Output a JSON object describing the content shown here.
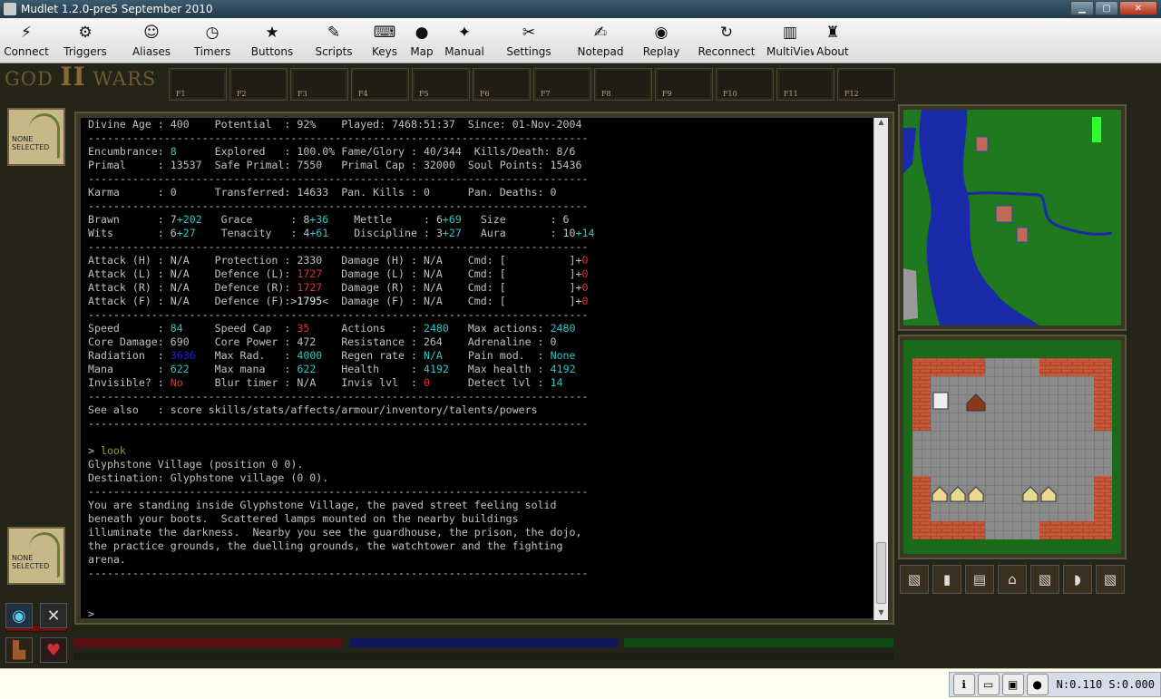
{
  "window": {
    "title": "Mudlet 1.2.0-pre5 September 2010"
  },
  "toolbar": [
    {
      "key": "connect",
      "label": "Connect",
      "icon": "⚡"
    },
    {
      "key": "triggers",
      "label": "Triggers",
      "icon": "⚙"
    },
    {
      "key": "aliases",
      "label": "Aliases",
      "icon": "☺"
    },
    {
      "key": "timers",
      "label": "Timers",
      "icon": "◷"
    },
    {
      "key": "buttons",
      "label": "Buttons",
      "icon": "★"
    },
    {
      "key": "scripts",
      "label": "Scripts",
      "icon": "✎"
    },
    {
      "key": "keys",
      "label": "Keys",
      "icon": "⌨"
    },
    {
      "key": "map",
      "label": "Map",
      "icon": "●"
    },
    {
      "key": "manual",
      "label": "Manual",
      "icon": "✦"
    },
    {
      "key": "settings",
      "label": "Settings",
      "icon": "✂"
    },
    {
      "key": "notepad",
      "label": "Notepad",
      "icon": "✍"
    },
    {
      "key": "replay",
      "label": "Replay",
      "icon": "◉"
    },
    {
      "key": "reconnect",
      "label": "Reconnect",
      "icon": "↻"
    },
    {
      "key": "multiview",
      "label": "MultiView",
      "icon": "▥"
    },
    {
      "key": "about",
      "label": "About",
      "icon": "♜"
    }
  ],
  "logo": {
    "text1": "GOD ",
    "text2": "II",
    "text3": " WARS"
  },
  "fkeys": [
    "F1",
    "F2",
    "F3",
    "F4",
    "F5",
    "F6",
    "F7",
    "F8",
    "F9",
    "F10",
    "F11",
    "F12"
  ],
  "portraits": {
    "top": "NONE\nSELECTED",
    "bottom": "NONE\nSELECTED"
  },
  "terminal": {
    "lines": [
      [
        [
          "Divine Age : 400    Potential  : 92%    Played: 7468:51:37  Since: 01-Nov-2004",
          ""
        ]
      ],
      [
        [
          "-------------------------------------------------------------------------------",
          ""
        ]
      ],
      [
        [
          "Encumbrance: ",
          ""
        ],
        [
          "8",
          "c"
        ],
        [
          "      Explored   : 100.0% Fame/Glory : 40/344  Kills/Death: 8/6",
          ""
        ]
      ],
      [
        [
          "Primal     : 13537  Safe Primal: 7550   Primal Cap : 32000  Soul Points: 15436",
          ""
        ]
      ],
      [
        [
          "-------------------------------------------------------------------------------",
          ""
        ]
      ],
      [
        [
          "Karma      : 0      Transferred: 14633  Pan. Kills : 0      Pan. Deaths: 0",
          ""
        ]
      ],
      [
        [
          "-------------------------------------------------------------------------------",
          ""
        ]
      ],
      [
        [
          "Brawn      : 7",
          ""
        ],
        [
          "+202",
          "c"
        ],
        [
          "   Grace      : 8",
          ""
        ],
        [
          "+36",
          "c"
        ],
        [
          "    Mettle     : 6",
          ""
        ],
        [
          "+69",
          "c"
        ],
        [
          "   Size       : 6",
          ""
        ]
      ],
      [
        [
          "Wits       : 6",
          ""
        ],
        [
          "+27",
          "c"
        ],
        [
          "    Tenacity   : 4",
          ""
        ],
        [
          "+61",
          "c"
        ],
        [
          "    Discipline : 3",
          ""
        ],
        [
          "+27",
          "c"
        ],
        [
          "   Aura       : 10",
          ""
        ],
        [
          "+14",
          "c"
        ]
      ],
      [
        [
          "-------------------------------------------------------------------------------",
          ""
        ]
      ],
      [
        [
          "Attack (H) : N/A    Protection : 2330   Damage (H) : N/A    Cmd: [          ]+",
          ""
        ],
        [
          "0",
          "r"
        ]
      ],
      [
        [
          "Attack (L) : N/A    Defence (L): ",
          ""
        ],
        [
          "1727",
          "r"
        ],
        [
          "   Damage (L) : N/A    Cmd: [          ]+",
          ""
        ],
        [
          "0",
          "r"
        ]
      ],
      [
        [
          "Attack (R) : N/A    Defence (R): ",
          ""
        ],
        [
          "1727",
          "r"
        ],
        [
          "   Damage (R) : N/A    Cmd: [          ]+",
          ""
        ],
        [
          "0",
          "r"
        ]
      ],
      [
        [
          "Attack (F) : N/A    Defence (F):>",
          ""
        ],
        [
          "1795",
          "w"
        ],
        [
          "<  Damage (F) : N/A    Cmd: [          ]+",
          ""
        ],
        [
          "0",
          "r"
        ]
      ],
      [
        [
          "-------------------------------------------------------------------------------",
          ""
        ]
      ],
      [
        [
          "Speed      : ",
          ""
        ],
        [
          "84",
          "c"
        ],
        [
          "     Speed Cap  : ",
          ""
        ],
        [
          "35",
          "r"
        ],
        [
          "     Actions    : ",
          ""
        ],
        [
          "2480",
          "c"
        ],
        [
          "   Max actions: ",
          ""
        ],
        [
          "2480",
          "c"
        ]
      ],
      [
        [
          "Core Damage: 690    Core Power : 472    Resistance : 264    Adrenaline : 0",
          ""
        ]
      ],
      [
        [
          "Radiation  : ",
          ""
        ],
        [
          "3636",
          "b"
        ],
        [
          "   Max Rad.   : ",
          ""
        ],
        [
          "4000",
          "c"
        ],
        [
          "   Regen rate : ",
          ""
        ],
        [
          "N/A",
          "c"
        ],
        [
          "    Pain mod.  : ",
          ""
        ],
        [
          "None",
          "c"
        ]
      ],
      [
        [
          "Mana       : ",
          ""
        ],
        [
          "622",
          "c"
        ],
        [
          "    Max mana   : ",
          ""
        ],
        [
          "622",
          "c"
        ],
        [
          "    Health     : ",
          ""
        ],
        [
          "4192",
          "c"
        ],
        [
          "   Max health : ",
          ""
        ],
        [
          "4192",
          "c"
        ]
      ],
      [
        [
          "Invisible? : ",
          ""
        ],
        [
          "No",
          "r"
        ],
        [
          "     Blur timer : N/A    Invis lvl  : ",
          ""
        ],
        [
          "0",
          "r"
        ],
        [
          "      Detect lvl : ",
          ""
        ],
        [
          "14",
          "c"
        ]
      ],
      [
        [
          "-------------------------------------------------------------------------------",
          ""
        ]
      ],
      [
        [
          "See also   : score skills/stats/affects/armour/inventory/talents/powers",
          ""
        ]
      ],
      [
        [
          "-------------------------------------------------------------------------------",
          ""
        ]
      ],
      [
        [
          "",
          ""
        ]
      ],
      [
        [
          "> ",
          ""
        ],
        [
          "look",
          "y"
        ]
      ],
      [
        [
          "Glyphstone Village",
          ""
        ],
        [
          " (position 0 0).",
          ""
        ]
      ],
      [
        [
          "Destination: Glyphstone village (0 0).",
          ""
        ]
      ],
      [
        [
          "-------------------------------------------------------------------------------",
          ""
        ]
      ],
      [
        [
          "You are standing inside Glyphstone Village, the paved street feeling solid",
          ""
        ]
      ],
      [
        [
          "beneath your boots.  Scattered lamps mounted on the nearby buildings",
          ""
        ]
      ],
      [
        [
          "illuminate the darkness.  Nearby you see the guardhouse, the prison, the dojo,",
          ""
        ]
      ],
      [
        [
          "the practice grounds, the duelling grounds, the watchtower and the fighting",
          ""
        ]
      ],
      [
        [
          "arena.",
          ""
        ]
      ],
      [
        [
          "-------------------------------------------------------------------------------",
          ""
        ]
      ],
      [
        [
          "",
          ""
        ]
      ],
      [
        [
          "",
          ""
        ]
      ],
      [
        [
          ">",
          ""
        ]
      ]
    ]
  },
  "gauges": {
    "health": 1.0,
    "mana": 1.0,
    "moves": 1.0,
    "colors": {
      "health": "#5a0e0e",
      "mana": "#10185a",
      "moves": "#0e4a14"
    }
  },
  "status": {
    "net": "N:0.110 S:0.000"
  },
  "colors": {
    "cyan": "#2ec4c4",
    "red": "#e03030",
    "blue": "#2020d8",
    "grass": "#1f7a1f",
    "water": "#1a2aa8",
    "brick": "#c8583a",
    "paving": "#8a8a8a"
  }
}
